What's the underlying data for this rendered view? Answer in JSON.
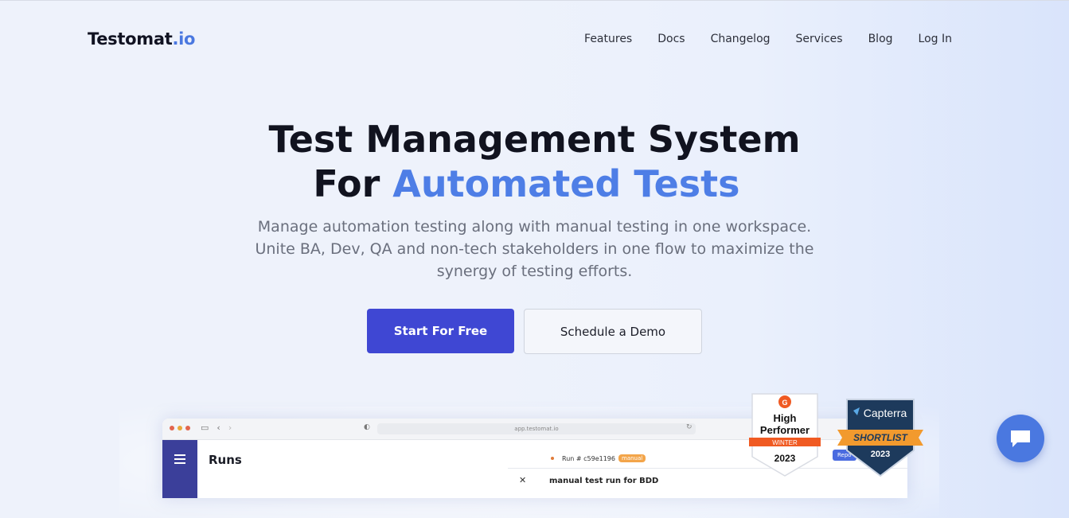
{
  "brand": {
    "logo_main": "Testomat",
    "logo_suffix": ".io"
  },
  "nav": {
    "items": [
      "Features",
      "Docs",
      "Changelog",
      "Services",
      "Blog",
      "Log In"
    ]
  },
  "hero": {
    "title_line1": "Test Management System",
    "title_line2_prefix": "For ",
    "title_line2_accent": "Automated Tests",
    "subtitle_lines": [
      "Manage automation testing along with manual testing in one workspace.",
      "Unite BA, Dev, QA and non-tech stakeholders in one flow to maximize the",
      "synergy of testing efforts."
    ],
    "primary_cta": "Start For Free",
    "secondary_cta": "Schedule a Demo"
  },
  "preview": {
    "url": "app.testomat.io",
    "page_title": "Runs",
    "run_label": "Run # c59e1196",
    "run_tag": "manual",
    "panel_title": "manual test run for BDD",
    "report_button": "Repo"
  },
  "badges": {
    "g2": {
      "line1": "High",
      "line2": "Performer",
      "season": "WINTER",
      "year": "2023"
    },
    "capterra": {
      "brand": "Capterra",
      "ribbon": "SHORTLIST",
      "year": "2023"
    }
  },
  "colors": {
    "accent": "#4e7ee6",
    "primary_button": "#3f47d3",
    "chat": "#4a78e0"
  }
}
